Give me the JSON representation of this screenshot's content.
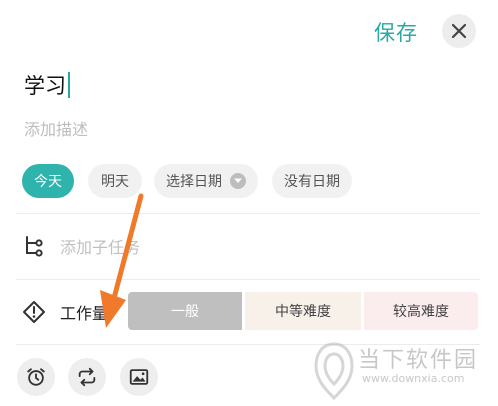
{
  "header": {
    "save_label": "保存",
    "close_icon": "close-icon"
  },
  "task": {
    "title": "学习",
    "description_placeholder": "添加描述"
  },
  "date_chips": [
    {
      "label": "今天",
      "selected": true
    },
    {
      "label": "明天",
      "selected": false
    },
    {
      "label": "选择日期",
      "selected": false
    },
    {
      "label": "没有日期",
      "selected": false
    }
  ],
  "subtask": {
    "icon": "subtask-branch-icon",
    "label": "添加子任务"
  },
  "difficulty": {
    "icon": "warning-diamond-icon",
    "label": "工作量",
    "options": [
      {
        "label": "一般",
        "selected": true
      },
      {
        "label": "中等难度",
        "selected": false
      },
      {
        "label": "较高难度",
        "selected": false
      }
    ]
  },
  "toolbar": {
    "items": [
      "alarm-clock-icon",
      "repeat-icon",
      "image-icon"
    ]
  },
  "watermark": {
    "title": "当下软件园",
    "url": "www.downxia.com"
  },
  "colors": {
    "accent": "#2aa9a4",
    "chip_active": "#2fb3ad",
    "arrow": "#f07a2a"
  }
}
